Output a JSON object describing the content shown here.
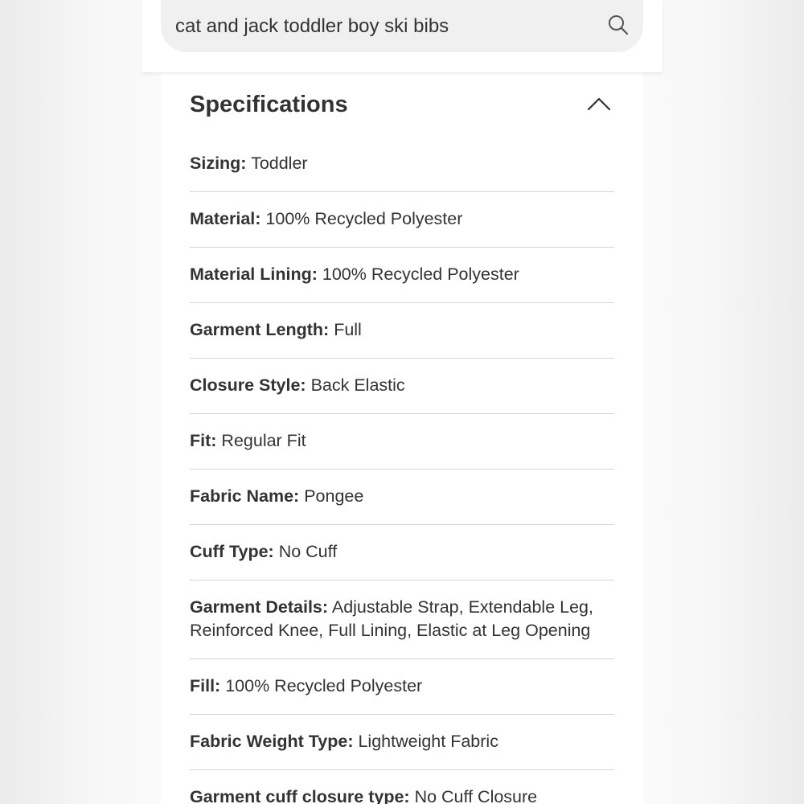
{
  "search": {
    "value": "cat and jack toddler boy ski bibs"
  },
  "section": {
    "title": "Specifications"
  },
  "specs": [
    {
      "label": "Sizing:",
      "value": "Toddler"
    },
    {
      "label": "Material:",
      "value": "100% Recycled Polyester"
    },
    {
      "label": "Material Lining:",
      "value": "100% Recycled Polyester"
    },
    {
      "label": "Garment Length:",
      "value": "Full"
    },
    {
      "label": "Closure Style:",
      "value": "Back Elastic"
    },
    {
      "label": "Fit:",
      "value": "Regular Fit"
    },
    {
      "label": "Fabric Name:",
      "value": "Pongee"
    },
    {
      "label": "Cuff Type:",
      "value": "No Cuff"
    },
    {
      "label": "Garment Details:",
      "value": "Adjustable Strap, Extendable Leg, Reinforced Knee, Full Lining, Elastic at Leg Opening"
    },
    {
      "label": "Fill:",
      "value": "100% Recycled Polyester"
    },
    {
      "label": "Fabric Weight Type:",
      "value": "Lightweight Fabric"
    },
    {
      "label": "Garment cuff closure type:",
      "value": "No Cuff Closure"
    }
  ],
  "icons": {
    "search": "search-icon",
    "collapse": "chevron-up-icon"
  },
  "colors": {
    "text": "#333333",
    "divider": "#d6d6d6",
    "search_bg": "#f0f0f0"
  }
}
